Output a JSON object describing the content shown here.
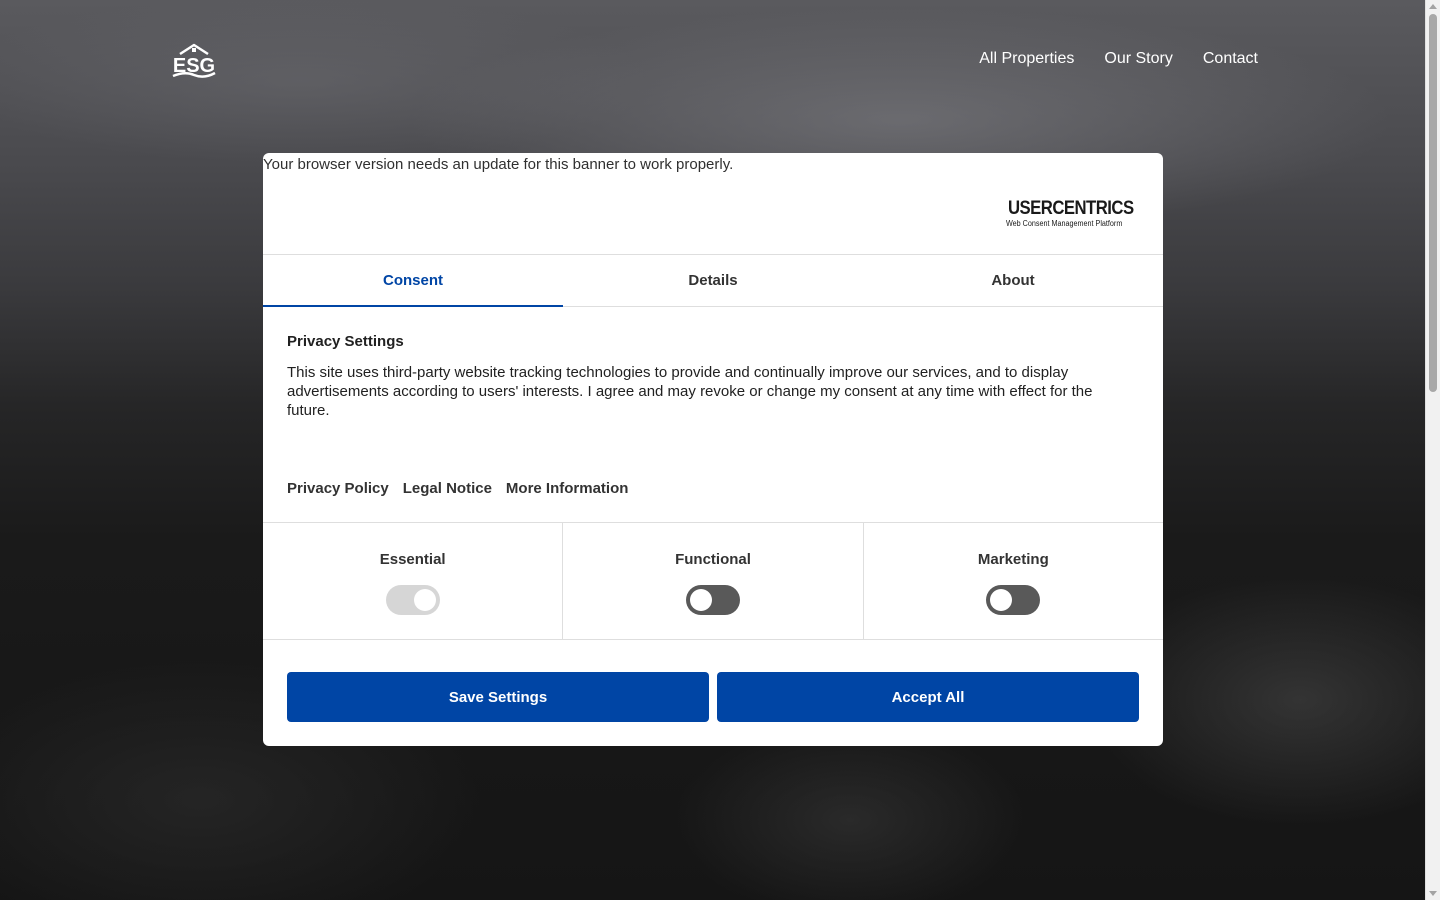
{
  "site": {
    "logo_text": "ESG",
    "nav": [
      {
        "label": "All Properties"
      },
      {
        "label": "Our Story"
      },
      {
        "label": "Contact"
      }
    ]
  },
  "consent_banner": {
    "browser_note": "Your browser version needs an update for this banner to work properly.",
    "brand": {
      "name": "USERCENTRICS",
      "tagline": "Web Consent Management Platform"
    },
    "tabs": [
      {
        "label": "Consent",
        "active": true
      },
      {
        "label": "Details",
        "active": false
      },
      {
        "label": "About",
        "active": false
      }
    ],
    "privacy": {
      "title": "Privacy Settings",
      "text": "This site uses third-party website tracking technologies to provide and continually improve our services, and to display advertisements according to users' interests. I agree and may revoke or change my consent at any time with effect for the future."
    },
    "links": [
      {
        "label": "Privacy Policy"
      },
      {
        "label": "Legal Notice"
      },
      {
        "label": "More Information"
      }
    ],
    "categories": [
      {
        "label": "Essential",
        "state": "on",
        "disabled": true
      },
      {
        "label": "Functional",
        "state": "off",
        "disabled": false
      },
      {
        "label": "Marketing",
        "state": "off",
        "disabled": false
      }
    ],
    "buttons": {
      "save": "Save Settings",
      "accept": "Accept All"
    },
    "colors": {
      "accent": "#0045a5",
      "toggle_off": "#595959",
      "toggle_disabled": "#d6d6d6"
    }
  }
}
